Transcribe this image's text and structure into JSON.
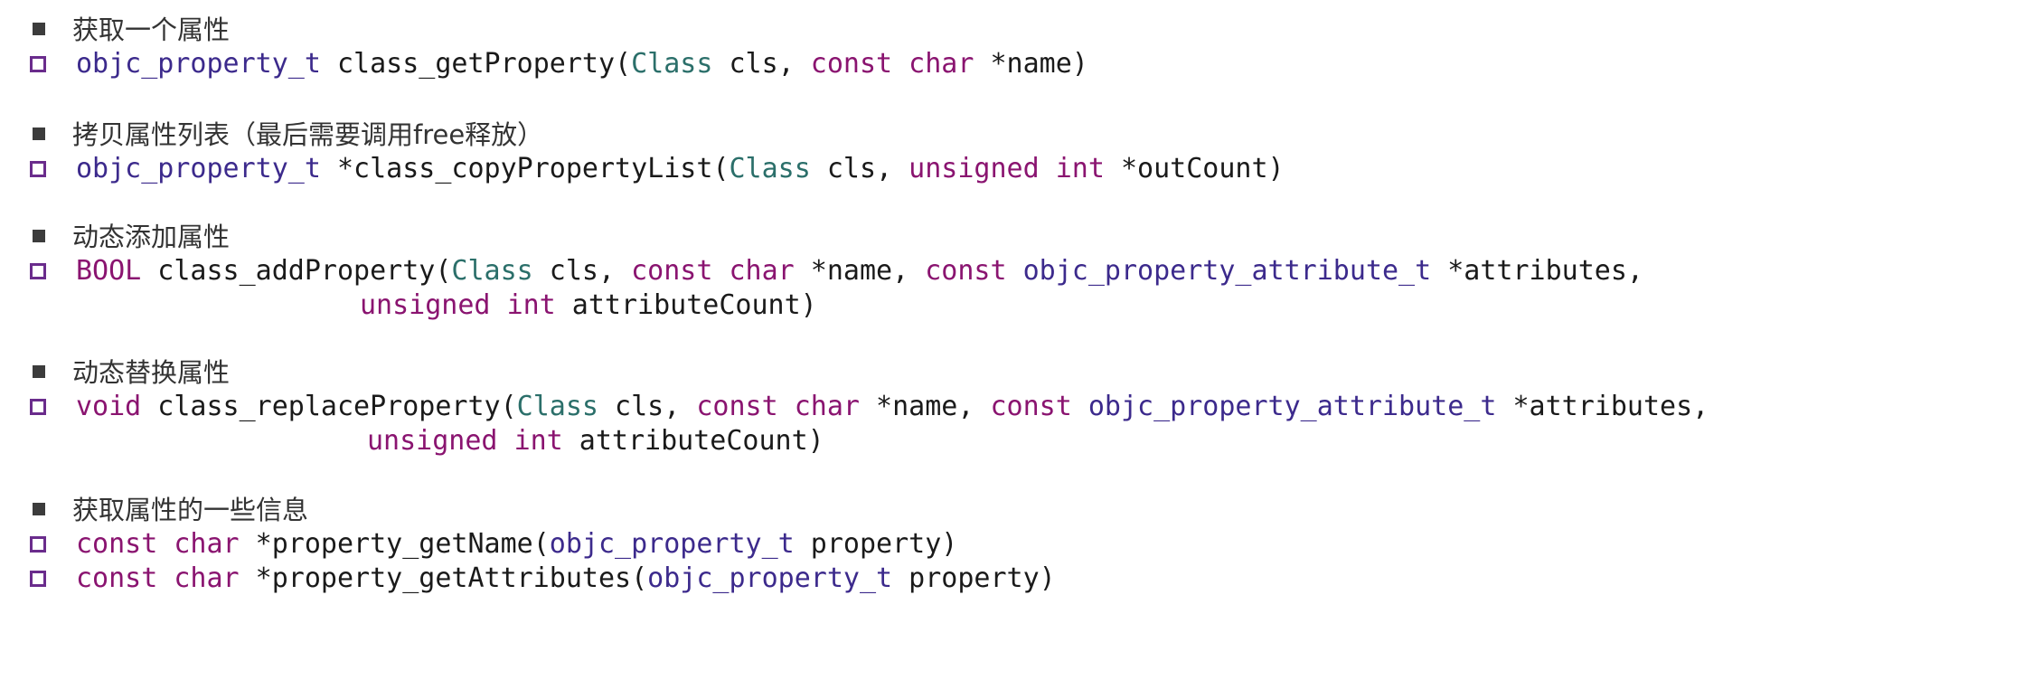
{
  "colors": {
    "keyword": "#8a1470",
    "type": "#3c2a8c",
    "class": "#2b6f6a",
    "plain": "#1a1a1a",
    "bullet_square": "#3c3c3c",
    "bullet_hollow": "#6a2c8c"
  },
  "sections": [
    {
      "heading": "获取一个属性",
      "lines": [
        [
          {
            "t": "objc_property_t",
            "c": "ty"
          },
          {
            "t": " class_getProperty(",
            "c": "df"
          },
          {
            "t": "Class",
            "c": "cl"
          },
          {
            "t": " cls, ",
            "c": "df"
          },
          {
            "t": "const",
            "c": "kw"
          },
          {
            "t": " ",
            "c": "df"
          },
          {
            "t": "char",
            "c": "kw"
          },
          {
            "t": " *name)",
            "c": "df"
          }
        ]
      ]
    },
    {
      "heading": "拷贝属性列表（最后需要调用free释放）",
      "lines": [
        [
          {
            "t": "objc_property_t",
            "c": "ty"
          },
          {
            "t": " *class_copyPropertyList(",
            "c": "df"
          },
          {
            "t": "Class",
            "c": "cl"
          },
          {
            "t": " cls, ",
            "c": "df"
          },
          {
            "t": "unsigned",
            "c": "kw"
          },
          {
            "t": " ",
            "c": "df"
          },
          {
            "t": "int",
            "c": "kw"
          },
          {
            "t": " *outCount)",
            "c": "df"
          }
        ]
      ]
    },
    {
      "heading": "动态添加属性",
      "lines": [
        [
          {
            "t": "BOOL",
            "c": "kw"
          },
          {
            "t": " class_addProperty(",
            "c": "df"
          },
          {
            "t": "Class",
            "c": "cl"
          },
          {
            "t": " cls, ",
            "c": "df"
          },
          {
            "t": "const",
            "c": "kw"
          },
          {
            "t": " ",
            "c": "df"
          },
          {
            "t": "char",
            "c": "kw"
          },
          {
            "t": " *name, ",
            "c": "df"
          },
          {
            "t": "const",
            "c": "kw"
          },
          {
            "t": " ",
            "c": "df"
          },
          {
            "t": "objc_property_attribute_t",
            "c": "ty"
          },
          {
            "t": " *attributes,",
            "c": "df"
          }
        ],
        [
          {
            "t": "unsigned",
            "c": "kw"
          },
          {
            "t": " ",
            "c": "df"
          },
          {
            "t": "int",
            "c": "kw"
          },
          {
            "t": " attributeCount)",
            "c": "df"
          }
        ]
      ]
    },
    {
      "heading": "动态替换属性",
      "lines": [
        [
          {
            "t": "void",
            "c": "kw"
          },
          {
            "t": " class_replaceProperty(",
            "c": "df"
          },
          {
            "t": "Class",
            "c": "cl"
          },
          {
            "t": " cls, ",
            "c": "df"
          },
          {
            "t": "const",
            "c": "kw"
          },
          {
            "t": " ",
            "c": "df"
          },
          {
            "t": "char",
            "c": "kw"
          },
          {
            "t": " *name, ",
            "c": "df"
          },
          {
            "t": "const",
            "c": "kw"
          },
          {
            "t": " ",
            "c": "df"
          },
          {
            "t": "objc_property_attribute_t",
            "c": "ty"
          },
          {
            "t": " *attributes,",
            "c": "df"
          }
        ],
        [
          {
            "t": "unsigned",
            "c": "kw"
          },
          {
            "t": " ",
            "c": "df"
          },
          {
            "t": "int",
            "c": "kw"
          },
          {
            "t": " attributeCount)",
            "c": "df"
          }
        ]
      ]
    },
    {
      "heading": "获取属性的一些信息",
      "lines": [
        [
          {
            "t": "const",
            "c": "kw"
          },
          {
            "t": " ",
            "c": "df"
          },
          {
            "t": "char",
            "c": "kw"
          },
          {
            "t": " *property_getName(",
            "c": "df"
          },
          {
            "t": "objc_property_t",
            "c": "ty"
          },
          {
            "t": " property)",
            "c": "df"
          }
        ],
        [
          {
            "t": "const",
            "c": "kw"
          },
          {
            "t": " ",
            "c": "df"
          },
          {
            "t": "char",
            "c": "kw"
          },
          {
            "t": " *property_getAttributes(",
            "c": "df"
          },
          {
            "t": "objc_property_t",
            "c": "ty"
          },
          {
            "t": " property)",
            "c": "df"
          }
        ]
      ]
    }
  ]
}
